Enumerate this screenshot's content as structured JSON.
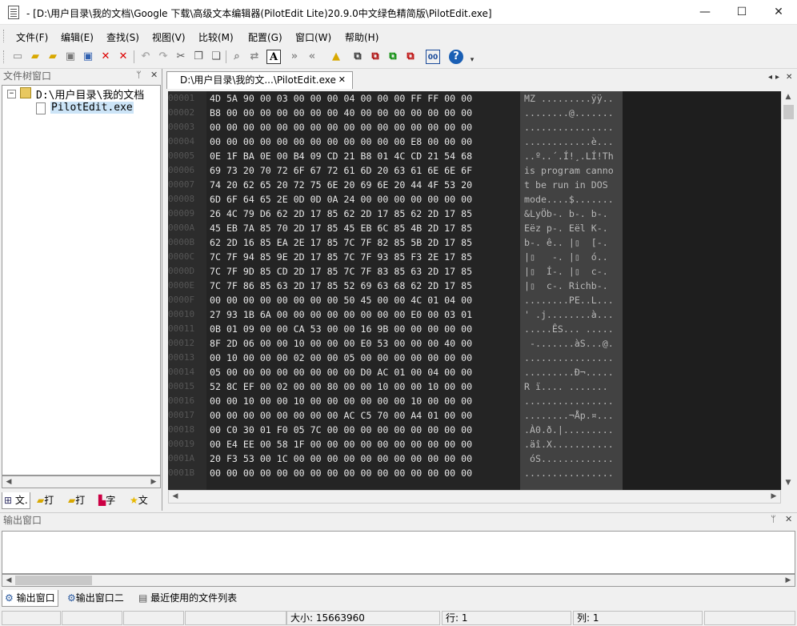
{
  "window": {
    "title": "- [D:\\用户目录\\我的文档\\Google 下载\\高级文本编辑器(PilotEdit Lite)20.9.0中文绿色精简版\\PilotEdit.exe]",
    "minimize_glyph": "—",
    "maximize_glyph": "☐",
    "close_glyph": "✕"
  },
  "menu": [
    "文件(F)",
    "编辑(E)",
    "查找(S)",
    "视图(V)",
    "比较(M)",
    "配置(G)",
    "窗口(W)",
    "帮助(H)"
  ],
  "toolbar_icons": [
    "new-file-icon",
    "open-folder-icon",
    "open-recent-icon",
    "save-icon",
    "save-all-icon",
    "close-file-icon",
    "close-all-icon",
    "undo-icon",
    "redo-icon",
    "cut-icon",
    "copy-icon",
    "paste-icon",
    "find-icon",
    "replace-icon",
    "font-icon",
    "indent-icon",
    "outdent-icon",
    "ftp-icon",
    "compare-icon",
    "compare-next-icon",
    "compare-prev-icon",
    "hex-convert-icon",
    "binary-icon",
    "help-icon"
  ],
  "tree_panel": {
    "title": "文件树窗口",
    "pin_glyph": "ᛘ",
    "close_glyph": "✕",
    "root_label": "D:\\用户目录\\我的文档",
    "file_label": "PilotEdit.exe",
    "tabs": [
      "文.",
      "打",
      "打",
      "字",
      "文"
    ]
  },
  "editor": {
    "tab_label": "D:\\用户目录\\我的文...\\PilotEdit.exe",
    "tab_close": "✕",
    "nav_left": "◂",
    "nav_right": "▸",
    "nav_close": "✕"
  },
  "hex_rows": [
    {
      "offset": "00001",
      "hex": "4D 5A 90 00 03 00 00 00 04 00 00 00 FF FF 00 00",
      "ascii": "MZ .........ÿÿ.."
    },
    {
      "offset": "00002",
      "hex": "B8 00 00 00 00 00 00 00 40 00 00 00 00 00 00 00",
      "ascii": "........@......."
    },
    {
      "offset": "00003",
      "hex": "00 00 00 00 00 00 00 00 00 00 00 00 00 00 00 00",
      "ascii": "................"
    },
    {
      "offset": "00004",
      "hex": "00 00 00 00 00 00 00 00 00 00 00 00 E8 00 00 00",
      "ascii": "............è..."
    },
    {
      "offset": "00005",
      "hex": "0E 1F BA 0E 00 B4 09 CD 21 B8 01 4C CD 21 54 68",
      "ascii": "..º..´.Í!¸.LÍ!Th"
    },
    {
      "offset": "00006",
      "hex": "69 73 20 70 72 6F 67 72 61 6D 20 63 61 6E 6E 6F",
      "ascii": "is program canno"
    },
    {
      "offset": "00007",
      "hex": "74 20 62 65 20 72 75 6E 20 69 6E 20 44 4F 53 20",
      "ascii": "t be run in DOS "
    },
    {
      "offset": "00008",
      "hex": "6D 6F 64 65 2E 0D 0D 0A 24 00 00 00 00 00 00 00",
      "ascii": "mode....$......."
    },
    {
      "offset": "00009",
      "hex": "26 4C 79 D6 62 2D 17 85 62 2D 17 85 62 2D 17 85",
      "ascii": "&LyÖb-. b-. b-."
    },
    {
      "offset": "0000A",
      "hex": "45 EB 7A 85 70 2D 17 85 45 EB 6C 85 4B 2D 17 85",
      "ascii": "Eëz p-. Eël K-."
    },
    {
      "offset": "0000B",
      "hex": "62 2D 16 85 EA 2E 17 85 7C 7F 82 85 5B 2D 17 85",
      "ascii": "b-. ê.. |▯  [-."
    },
    {
      "offset": "0000C",
      "hex": "7C 7F 94 85 9E 2D 17 85 7C 7F 93 85 F3 2E 17 85",
      "ascii": "|▯   -. |▯  ó.."
    },
    {
      "offset": "0000D",
      "hex": "7C 7F 9D 85 CD 2D 17 85 7C 7F 83 85 63 2D 17 85",
      "ascii": "|▯  Í-. |▯  c-."
    },
    {
      "offset": "0000E",
      "hex": "7C 7F 86 85 63 2D 17 85 52 69 63 68 62 2D 17 85",
      "ascii": "|▯  c-. Richb-."
    },
    {
      "offset": "0000F",
      "hex": "00 00 00 00 00 00 00 00 50 45 00 00 4C 01 04 00",
      "ascii": "........PE..L..."
    },
    {
      "offset": "00010",
      "hex": "27 93 1B 6A 00 00 00 00 00 00 00 00 E0 00 03 01",
      "ascii": "' .j........à..."
    },
    {
      "offset": "00011",
      "hex": "0B 01 09 00 00 CA 53 00 00 16 9B 00 00 00 00 00",
      "ascii": ".....ÊS... ....."
    },
    {
      "offset": "00012",
      "hex": "8F 2D 06 00 00 10 00 00 00 E0 53 00 00 00 40 00",
      "ascii": " -.......àS...@."
    },
    {
      "offset": "00013",
      "hex": "00 10 00 00 00 02 00 00 05 00 00 00 00 00 00 00",
      "ascii": "................"
    },
    {
      "offset": "00014",
      "hex": "05 00 00 00 00 00 00 00 00 D0 AC 01 00 04 00 00",
      "ascii": ".........Ð¬....."
    },
    {
      "offset": "00015",
      "hex": "52 8C EF 00 02 00 00 80 00 00 10 00 00 10 00 00",
      "ascii": "R ï.... ......."
    },
    {
      "offset": "00016",
      "hex": "00 00 10 00 00 10 00 00 00 00 00 00 10 00 00 00",
      "ascii": "................"
    },
    {
      "offset": "00017",
      "hex": "00 00 00 00 00 00 00 00 AC C5 70 00 A4 01 00 00",
      "ascii": "........¬Åp.¤..."
    },
    {
      "offset": "00018",
      "hex": "00 C0 30 01 F0 05 7C 00 00 00 00 00 00 00 00 00",
      "ascii": ".À0.ð.|........."
    },
    {
      "offset": "00019",
      "hex": "00 E4 EE 00 58 1F 00 00 00 00 00 00 00 00 00 00",
      "ascii": ".äî.X..........."
    },
    {
      "offset": "0001A",
      "hex": "20 F3 53 00 1C 00 00 00 00 00 00 00 00 00 00 00",
      "ascii": " óS............."
    },
    {
      "offset": "0001B",
      "hex": "00 00 00 00 00 00 00 00 00 00 00 00 00 00 00 00",
      "ascii": "................"
    }
  ],
  "output_panel": {
    "title": "输出窗口",
    "pin_glyph": "ᛘ",
    "close_glyph": "✕",
    "tabs": [
      "输出窗口",
      "输出窗口二",
      "最近使用的文件列表"
    ]
  },
  "status": {
    "size_text": "大小: 15663960",
    "line_text": "行: 1",
    "col_text": "列: 1"
  }
}
